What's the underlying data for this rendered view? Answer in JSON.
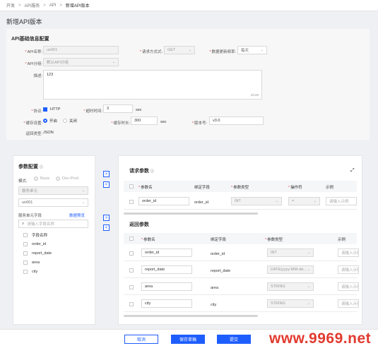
{
  "breadcrumb": [
    "开发",
    "API服务",
    "API",
    "新增API版本"
  ],
  "page_title": "新增API版本",
  "basic": {
    "title": "API基础信息配置",
    "api_name_label": "API名称:",
    "api_name_value": "un001",
    "request_method_label": "请求方式式:",
    "request_method_value": "GET",
    "update_freq_label": "数据更新频率:",
    "update_freq_value": "每天",
    "api_group_label": "API分组:",
    "api_group_value": "默认API分组",
    "desc_label": "描述:",
    "desc_value": "123",
    "desc_count": "3/128",
    "protocol_label": "协议:",
    "protocol_value": "HTTP",
    "timeout_label": "超时时间:",
    "timeout_value": "3",
    "timeout_unit": "sec",
    "cache_label": "缓存设置:",
    "cache_on": "开启",
    "cache_off": "关闭",
    "cache_time_label": "缓存时长:",
    "cache_time_value": "300",
    "cache_time_unit": "sec",
    "version_label": "版本号:",
    "version_value": "v3.0",
    "return_type_label": "返回类型:",
    "return_type_value": "JSON"
  },
  "params": {
    "title": "参数配置",
    "mode_label": "模式:",
    "mode_basic": "Basic",
    "mode_devprod": "Dev-Prod",
    "service_unit_placeholder": "服务单元",
    "service_unit_value": "un001",
    "field_label": "服务单元字段",
    "data_preview": "数据预览",
    "search_placeholder": "请输入字段名称",
    "field_list_header": "字段名称",
    "fields": [
      "order_id",
      "report_date",
      "area",
      "city"
    ]
  },
  "request": {
    "title": "请求参数",
    "headers": [
      "参数名",
      "绑定字段",
      "参数类型",
      "操作符",
      "示例"
    ],
    "row": {
      "name": "order_id",
      "bind": "order_id",
      "type": "INT",
      "op": "=",
      "example_placeholder": "请输入示例"
    }
  },
  "response": {
    "title": "返回参数",
    "headers": [
      "参数名",
      "绑定字段",
      "参数类型",
      "示例"
    ],
    "rows": [
      {
        "name": "order_id",
        "bind": "order_id",
        "type": "INT",
        "example_placeholder": "请输入示例"
      },
      {
        "name": "report_date",
        "bind": "report_date",
        "type": "DATE(yyyy-MM-dd...",
        "example_placeholder": "请输入示例"
      },
      {
        "name": "area",
        "bind": "area",
        "type": "STRING",
        "example_placeholder": "请输入示例"
      },
      {
        "name": "city",
        "bind": "city",
        "type": "STRING",
        "example_placeholder": "请输入示例"
      }
    ]
  },
  "footer": {
    "cancel": "取消",
    "save_draft": "保存草稿",
    "submit": "提交"
  },
  "watermark": "www.9969.net",
  "colors": {
    "accent": "#1e5eff",
    "required": "#e54545",
    "watermark": "#e23a2e"
  }
}
